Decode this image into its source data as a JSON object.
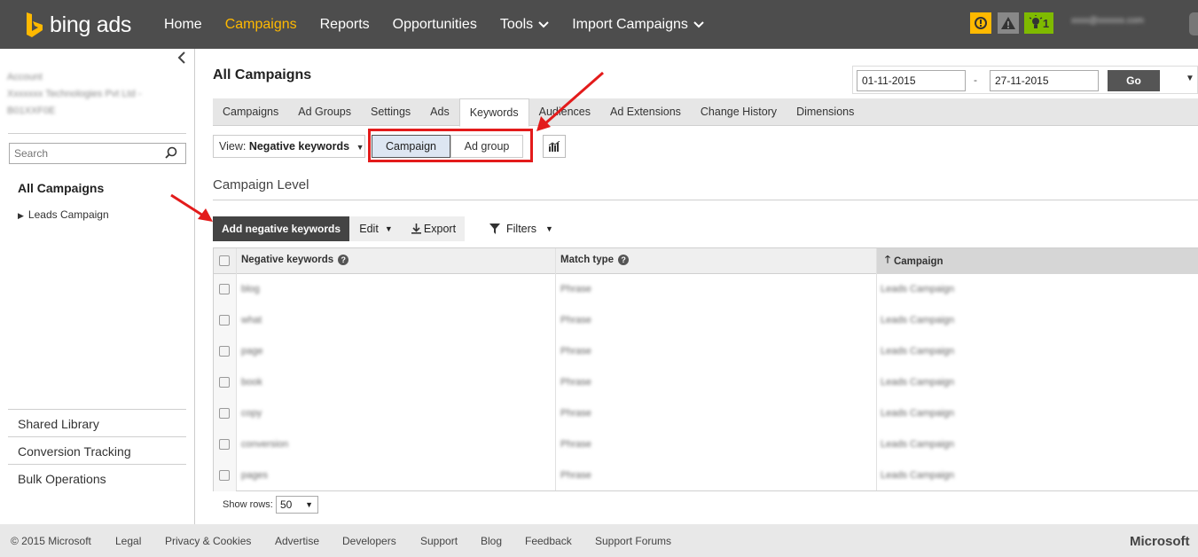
{
  "app": {
    "logo_text": "bing ads"
  },
  "topnav": {
    "items": [
      {
        "label": "Home",
        "active": false,
        "dropdown": false
      },
      {
        "label": "Campaigns",
        "active": true,
        "dropdown": false
      },
      {
        "label": "Reports",
        "active": false,
        "dropdown": false
      },
      {
        "label": "Opportunities",
        "active": false,
        "dropdown": false
      },
      {
        "label": "Tools",
        "active": false,
        "dropdown": true
      },
      {
        "label": "Import Campaigns",
        "active": false,
        "dropdown": true
      }
    ],
    "alerts": {
      "yellow": "!",
      "gray": "!",
      "green_count": "1"
    },
    "user_email": "xxxx@xxxxxx.com"
  },
  "sidebar": {
    "account_label": "Account",
    "account_name": "Xxxxxxx Technologies Pvt Ltd -",
    "account_id": "B01XXF0E",
    "search_placeholder": "Search",
    "all_campaigns": "All Campaigns",
    "campaign": "Leads Campaign",
    "links": [
      "Shared Library",
      "Conversion Tracking",
      "Bulk Operations"
    ]
  },
  "main": {
    "title": "All Campaigns",
    "date_from": "01-11-2015",
    "date_sep": "-",
    "date_to": "27-11-2015",
    "go": "Go",
    "tabs": [
      "Campaigns",
      "Ad Groups",
      "Settings",
      "Ads",
      "Keywords",
      "Audiences",
      "Ad Extensions",
      "Change History",
      "Dimensions"
    ],
    "active_tab": "Keywords",
    "view_label": "View:",
    "view_value": "Negative keywords",
    "seg_campaign": "Campaign",
    "seg_adgroup": "Ad group",
    "section_title": "Campaign Level",
    "add_button": "Add negative keywords",
    "edit_button": "Edit",
    "export_button": "Export",
    "filters_button": "Filters"
  },
  "table": {
    "headers": {
      "keyword": "Negative keywords",
      "match": "Match type",
      "campaign": "Campaign"
    },
    "rows": [
      {
        "keyword": "blog",
        "match": "Phrase",
        "campaign": "Leads Campaign"
      },
      {
        "keyword": "what",
        "match": "Phrase",
        "campaign": "Leads Campaign"
      },
      {
        "keyword": "page",
        "match": "Phrase",
        "campaign": "Leads Campaign"
      },
      {
        "keyword": "book",
        "match": "Phrase",
        "campaign": "Leads Campaign"
      },
      {
        "keyword": "copy",
        "match": "Phrase",
        "campaign": "Leads Campaign"
      },
      {
        "keyword": "conversion",
        "match": "Phrase",
        "campaign": "Leads Campaign"
      },
      {
        "keyword": "pages",
        "match": "Phrase",
        "campaign": "Leads Campaign"
      }
    ],
    "show_rows_label": "Show rows:",
    "show_rows_value": "50"
  },
  "footer": {
    "items": [
      "© 2015 Microsoft",
      "Legal",
      "Privacy & Cookies",
      "Advertise",
      "Developers",
      "Support",
      "Blog",
      "Feedback",
      "Support Forums"
    ],
    "brand": "Microsoft"
  },
  "colors": {
    "topbar": "#4d4d4d",
    "active_nav": "#ffb900",
    "annotation_red": "#e31b1b"
  }
}
